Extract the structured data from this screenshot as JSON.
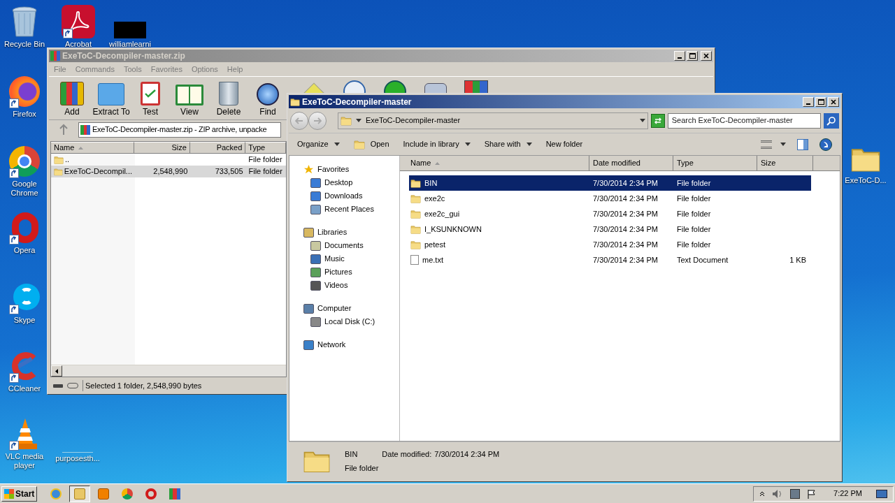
{
  "desktop": {
    "icons": [
      {
        "label": "Recycle Bin",
        "kind": "recycle"
      },
      {
        "label": "Acrobat",
        "kind": "acrobat"
      },
      {
        "label": "williamlearni",
        "kind": "redacted"
      },
      {
        "label": "Firefox",
        "kind": "firefox"
      },
      {
        "label": "Google Chrome",
        "kind": "chrome"
      },
      {
        "label": "Opera",
        "kind": "opera"
      },
      {
        "label": "Skype",
        "kind": "skype"
      },
      {
        "label": "CCleaner",
        "kind": "ccleaner"
      },
      {
        "label": "VLC media player",
        "kind": "vlc"
      },
      {
        "label": "purposesth...",
        "kind": "blank"
      },
      {
        "label": "ExeToC-D...",
        "kind": "folder"
      }
    ]
  },
  "winrar": {
    "title": "ExeToC-Decompiler-master.zip",
    "menu": [
      "File",
      "Commands",
      "Tools",
      "Favorites",
      "Options",
      "Help"
    ],
    "toolbar": [
      {
        "label": "Add",
        "kind": "add"
      },
      {
        "label": "Extract To",
        "kind": "extract"
      },
      {
        "label": "Test",
        "kind": "test"
      },
      {
        "label": "View",
        "kind": "view"
      },
      {
        "label": "Delete",
        "kind": "delete"
      },
      {
        "label": "Find",
        "kind": "find"
      }
    ],
    "toolbar_hidden": [
      {
        "kind": "wizard"
      },
      {
        "kind": "info"
      },
      {
        "kind": "scan"
      },
      {
        "kind": "comment"
      },
      {
        "kind": "sfx"
      }
    ],
    "address": "ExeToC-Decompiler-master.zip - ZIP archive, unpacke",
    "columns": [
      {
        "label": "Name",
        "sorted": true
      },
      {
        "label": "Size",
        "sorted": false
      },
      {
        "label": "Packed",
        "sorted": false
      },
      {
        "label": "Type",
        "sorted": false
      }
    ],
    "rows": [
      {
        "name": "..",
        "type": "File folder",
        "selected": false
      },
      {
        "name": "ExeToC-Decompil...",
        "size": "2,548,990",
        "packed": "733,505",
        "type": "File folder",
        "selected": true
      }
    ],
    "status": "Selected 1 folder, 2,548,990 bytes"
  },
  "explorer": {
    "title": "ExeToC-Decompiler-master",
    "breadcrumb": "ExeToC-Decompiler-master",
    "search": {
      "placeholder": "Search ExeToC-Decompiler-master"
    },
    "commands": [
      {
        "label": "Organize",
        "dropdown": true,
        "kind": "text"
      },
      {
        "label": "Open",
        "dropdown": false,
        "kind": "open"
      },
      {
        "label": "Include in library",
        "dropdown": true,
        "kind": "text"
      },
      {
        "label": "Share with",
        "dropdown": true,
        "kind": "text"
      },
      {
        "label": "New folder",
        "dropdown": false,
        "kind": "text"
      }
    ],
    "nav": [
      {
        "label": "Favorites",
        "kind": "star",
        "children": [
          {
            "label": "Desktop",
            "kind": "desktop"
          },
          {
            "label": "Downloads",
            "kind": "downloads"
          },
          {
            "label": "Recent Places",
            "kind": "recent"
          }
        ]
      },
      {
        "label": "Libraries",
        "kind": "library",
        "children": [
          {
            "label": "Documents",
            "kind": "documents"
          },
          {
            "label": "Music",
            "kind": "music"
          },
          {
            "label": "Pictures",
            "kind": "pictures"
          },
          {
            "label": "Videos",
            "kind": "videos"
          }
        ]
      },
      {
        "label": "Computer",
        "kind": "computer",
        "children": [
          {
            "label": "Local Disk (C:)",
            "kind": "disk"
          }
        ]
      },
      {
        "label": "Network",
        "kind": "network"
      }
    ],
    "columns": [
      {
        "label": "Name",
        "sorted": true
      },
      {
        "label": "Date modified",
        "sorted": false
      },
      {
        "label": "Type",
        "sorted": false
      },
      {
        "label": "Size",
        "sorted": false
      }
    ],
    "files": [
      {
        "name": "BIN",
        "date": "7/30/2014 2:34 PM",
        "type": "File folder",
        "kind": "folder",
        "selected": true
      },
      {
        "name": "exe2c",
        "date": "7/30/2014 2:34 PM",
        "type": "File folder",
        "kind": "folder",
        "selected": false
      },
      {
        "name": "exe2c_gui",
        "date": "7/30/2014 2:34 PM",
        "type": "File folder",
        "kind": "folder",
        "selected": false
      },
      {
        "name": "I_KSUNKNOWN",
        "date": "7/30/2014 2:34 PM",
        "type": "File folder",
        "kind": "folder",
        "selected": false
      },
      {
        "name": "petest",
        "date": "7/30/2014 2:34 PM",
        "type": "File folder",
        "kind": "folder",
        "selected": false
      },
      {
        "name": "me.txt",
        "date": "7/30/2014 2:34 PM",
        "type": "Text Document",
        "size": "1 KB",
        "kind": "text",
        "selected": false
      }
    ],
    "details": {
      "name": "BIN",
      "date_label": "Date modified:",
      "date": "7/30/2014 2:34 PM",
      "type": "File folder"
    }
  },
  "taskbar": {
    "start": "Start",
    "apps": [
      {
        "kind": "ie",
        "selected": false
      },
      {
        "kind": "explorer",
        "selected": true
      },
      {
        "kind": "media",
        "selected": false
      },
      {
        "kind": "chrome",
        "selected": false
      },
      {
        "kind": "opera",
        "selected": false
      },
      {
        "kind": "winrar",
        "selected": false
      }
    ],
    "clock": "7:22 PM"
  }
}
